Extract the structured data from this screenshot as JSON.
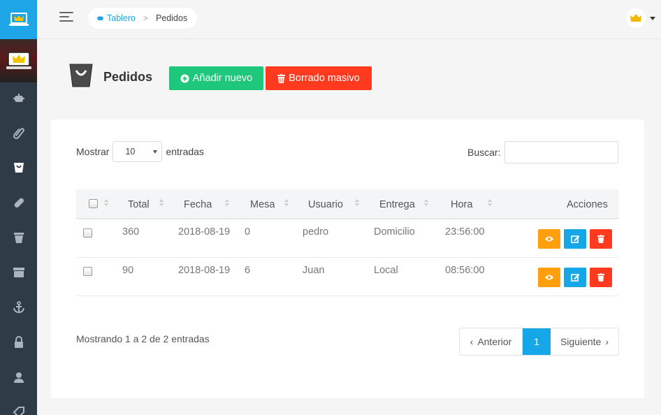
{
  "breadcrumb": {
    "home_label": "Tablero",
    "separator": ">",
    "current": "Pedidos"
  },
  "page": {
    "title": "Pedidos",
    "add_label": "Añadir nuevo",
    "bulk_delete_label": "Borrado masivo"
  },
  "table_controls": {
    "show_label": "Mostrar",
    "length_value": "10",
    "entries_label": "entradas",
    "search_label": "Buscar:"
  },
  "columns": {
    "total": "Total",
    "fecha": "Fecha",
    "mesa": "Mesa",
    "usuario": "Usuario",
    "entrega": "Entrega",
    "hora": "Hora",
    "acciones": "Acciones"
  },
  "rows": [
    {
      "total": "360",
      "fecha": "2018-08-19",
      "mesa": "0",
      "usuario": "pedro",
      "entrega": "Domicilio",
      "hora": "23:56:00"
    },
    {
      "total": "90",
      "fecha": "2018-08-19",
      "mesa": "6",
      "usuario": "Juan",
      "entrega": "Local",
      "hora": "08:56:00"
    }
  ],
  "footer": {
    "info": "Mostrando 1 a 2 de 2 entradas",
    "prev_label": "Anterior",
    "current_page": "1",
    "next_label": "Siguiente"
  },
  "sidebar_icons": [
    "crown-laptop-logo-icon",
    "profile-crown-icon",
    "dish-icon",
    "paperclip-icon",
    "bag-icon",
    "pill-icon",
    "cup-icon",
    "box-icon",
    "anchor-icon",
    "lock-icon",
    "user-icon",
    "tag-icon"
  ],
  "colors": {
    "accent": "#1ea6e8",
    "add": "#1ec77b",
    "danger": "#ff3a1e",
    "view": "#ff9f0e",
    "sidebar": "#2f3b46"
  }
}
